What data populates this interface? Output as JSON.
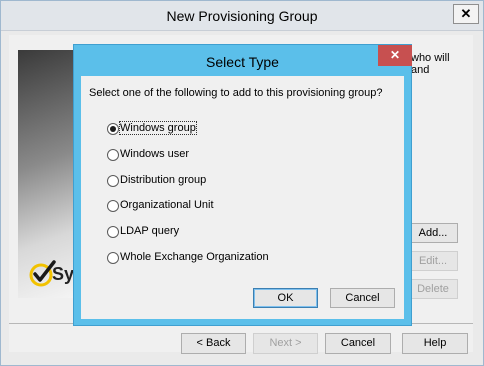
{
  "parent_window": {
    "title": "New Provisioning Group",
    "close_glyph": "✕",
    "description_line1": "who will",
    "description_line2": "and",
    "logo_text": "Sy",
    "buttons": {
      "add": "Add...",
      "edit": "Edit...",
      "delete": "Delete"
    },
    "nav": {
      "back": "< Back",
      "next": "Next >",
      "cancel": "Cancel",
      "help": "Help"
    }
  },
  "dialog": {
    "title": "Select Type",
    "close_glyph": "✕",
    "prompt": "Select one of the following to add to this provisioning group?",
    "options": [
      {
        "label": "Windows group",
        "selected": true
      },
      {
        "label": "Windows user",
        "selected": false
      },
      {
        "label": "Distribution group",
        "selected": false
      },
      {
        "label": "Organizational Unit",
        "selected": false
      },
      {
        "label": "LDAP query",
        "selected": false
      },
      {
        "label": "Whole Exchange Organization",
        "selected": false
      }
    ],
    "ok": "OK",
    "cancel": "Cancel"
  },
  "colors": {
    "dialog_frame": "#5bbfea",
    "close_button": "#c75050",
    "logo_check": "#f2c200"
  }
}
